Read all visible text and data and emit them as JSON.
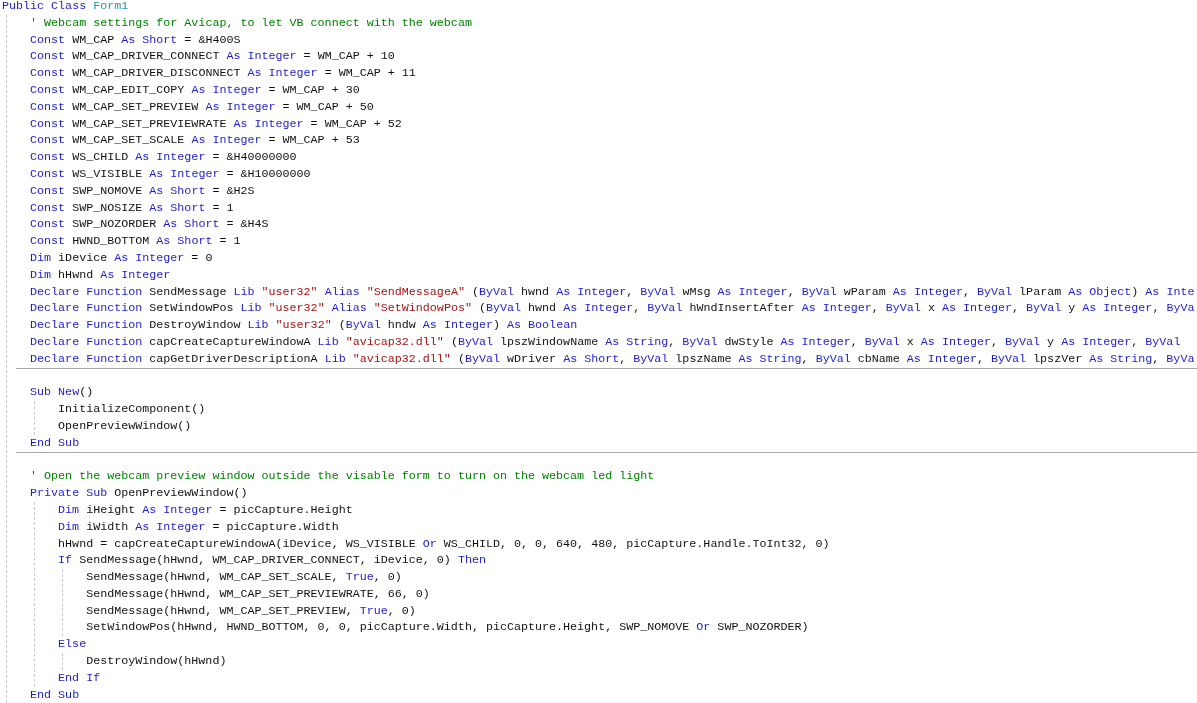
{
  "editor": {
    "lines": [
      {
        "tokens": [
          {
            "kind": "keyword",
            "text": "Public Class "
          },
          {
            "kind": "type",
            "text": "Form1"
          }
        ],
        "children": [
          {
            "tokens": [
              {
                "kind": "comment",
                "text": "' Webcam settings for Avicap, to let VB connect with the webcam"
              }
            ]
          },
          {
            "tokens": [
              {
                "kind": "keyword",
                "text": "Const"
              },
              {
                "kind": "plain",
                "text": " WM_CAP "
              },
              {
                "kind": "keyword",
                "text": "As Short"
              },
              {
                "kind": "plain",
                "text": " = &H400S"
              }
            ]
          },
          {
            "tokens": [
              {
                "kind": "keyword",
                "text": "Const"
              },
              {
                "kind": "plain",
                "text": " WM_CAP_DRIVER_CONNECT "
              },
              {
                "kind": "keyword",
                "text": "As Integer"
              },
              {
                "kind": "plain",
                "text": " = WM_CAP + 10"
              }
            ]
          },
          {
            "tokens": [
              {
                "kind": "keyword",
                "text": "Const"
              },
              {
                "kind": "plain",
                "text": " WM_CAP_DRIVER_DISCONNECT "
              },
              {
                "kind": "keyword",
                "text": "As Integer"
              },
              {
                "kind": "plain",
                "text": " = WM_CAP + 11"
              }
            ]
          },
          {
            "tokens": [
              {
                "kind": "keyword",
                "text": "Const"
              },
              {
                "kind": "plain",
                "text": " WM_CAP_EDIT_COPY "
              },
              {
                "kind": "keyword",
                "text": "As Integer"
              },
              {
                "kind": "plain",
                "text": " = WM_CAP + 30"
              }
            ]
          },
          {
            "tokens": [
              {
                "kind": "keyword",
                "text": "Const"
              },
              {
                "kind": "plain",
                "text": " WM_CAP_SET_PREVIEW "
              },
              {
                "kind": "keyword",
                "text": "As Integer"
              },
              {
                "kind": "plain",
                "text": " = WM_CAP + 50"
              }
            ]
          },
          {
            "tokens": [
              {
                "kind": "keyword",
                "text": "Const"
              },
              {
                "kind": "plain",
                "text": " WM_CAP_SET_PREVIEWRATE "
              },
              {
                "kind": "keyword",
                "text": "As Integer"
              },
              {
                "kind": "plain",
                "text": " = WM_CAP + 52"
              }
            ]
          },
          {
            "tokens": [
              {
                "kind": "keyword",
                "text": "Const"
              },
              {
                "kind": "plain",
                "text": " WM_CAP_SET_SCALE "
              },
              {
                "kind": "keyword",
                "text": "As Integer"
              },
              {
                "kind": "plain",
                "text": " = WM_CAP + 53"
              }
            ]
          },
          {
            "tokens": [
              {
                "kind": "keyword",
                "text": "Const"
              },
              {
                "kind": "plain",
                "text": " WS_CHILD "
              },
              {
                "kind": "keyword",
                "text": "As Integer"
              },
              {
                "kind": "plain",
                "text": " = &H40000000"
              }
            ]
          },
          {
            "tokens": [
              {
                "kind": "keyword",
                "text": "Const"
              },
              {
                "kind": "plain",
                "text": " WS_VISIBLE "
              },
              {
                "kind": "keyword",
                "text": "As Integer"
              },
              {
                "kind": "plain",
                "text": " = &H10000000"
              }
            ]
          },
          {
            "tokens": [
              {
                "kind": "keyword",
                "text": "Const"
              },
              {
                "kind": "plain",
                "text": " SWP_NOMOVE "
              },
              {
                "kind": "keyword",
                "text": "As Short"
              },
              {
                "kind": "plain",
                "text": " = &H2S"
              }
            ]
          },
          {
            "tokens": [
              {
                "kind": "keyword",
                "text": "Const"
              },
              {
                "kind": "plain",
                "text": " SWP_NOSIZE "
              },
              {
                "kind": "keyword",
                "text": "As Short"
              },
              {
                "kind": "plain",
                "text": " = 1"
              }
            ]
          },
          {
            "tokens": [
              {
                "kind": "keyword",
                "text": "Const"
              },
              {
                "kind": "plain",
                "text": " SWP_NOZORDER "
              },
              {
                "kind": "keyword",
                "text": "As Short"
              },
              {
                "kind": "plain",
                "text": " = &H4S"
              }
            ]
          },
          {
            "tokens": [
              {
                "kind": "keyword",
                "text": "Const"
              },
              {
                "kind": "plain",
                "text": " HWND_BOTTOM "
              },
              {
                "kind": "keyword",
                "text": "As Short"
              },
              {
                "kind": "plain",
                "text": " = 1"
              }
            ]
          },
          {
            "tokens": [
              {
                "kind": "keyword",
                "text": "Dim"
              },
              {
                "kind": "plain",
                "text": " iDevice "
              },
              {
                "kind": "keyword",
                "text": "As Integer"
              },
              {
                "kind": "plain",
                "text": " = 0"
              }
            ]
          },
          {
            "tokens": [
              {
                "kind": "keyword",
                "text": "Dim"
              },
              {
                "kind": "plain",
                "text": " hHwnd "
              },
              {
                "kind": "keyword",
                "text": "As Integer"
              }
            ]
          },
          {
            "tokens": [
              {
                "kind": "keyword",
                "text": "Declare Function"
              },
              {
                "kind": "plain",
                "text": " SendMessage "
              },
              {
                "kind": "keyword",
                "text": "Lib "
              },
              {
                "kind": "string",
                "text": "\"user32\""
              },
              {
                "kind": "keyword",
                "text": " Alias "
              },
              {
                "kind": "string",
                "text": "\"SendMessageA\""
              },
              {
                "kind": "plain",
                "text": " ("
              },
              {
                "kind": "keyword",
                "text": "ByVal"
              },
              {
                "kind": "plain",
                "text": " hwnd "
              },
              {
                "kind": "keyword",
                "text": "As Integer"
              },
              {
                "kind": "plain",
                "text": ", "
              },
              {
                "kind": "keyword",
                "text": "ByVal"
              },
              {
                "kind": "plain",
                "text": " wMsg "
              },
              {
                "kind": "keyword",
                "text": "As Integer"
              },
              {
                "kind": "plain",
                "text": ", "
              },
              {
                "kind": "keyword",
                "text": "ByVal"
              },
              {
                "kind": "plain",
                "text": " wParam "
              },
              {
                "kind": "keyword",
                "text": "As Integer"
              },
              {
                "kind": "plain",
                "text": ", "
              },
              {
                "kind": "keyword",
                "text": "ByVal"
              },
              {
                "kind": "plain",
                "text": " lParam "
              },
              {
                "kind": "keyword",
                "text": "As Object"
              },
              {
                "kind": "plain",
                "text": ") "
              },
              {
                "kind": "keyword",
                "text": "As Inte"
              }
            ]
          },
          {
            "tokens": [
              {
                "kind": "keyword",
                "text": "Declare Function"
              },
              {
                "kind": "plain",
                "text": " SetWindowPos "
              },
              {
                "kind": "keyword",
                "text": "Lib "
              },
              {
                "kind": "string",
                "text": "\"user32\""
              },
              {
                "kind": "keyword",
                "text": " Alias "
              },
              {
                "kind": "string",
                "text": "\"SetWindowPos\""
              },
              {
                "kind": "plain",
                "text": " ("
              },
              {
                "kind": "keyword",
                "text": "ByVal"
              },
              {
                "kind": "plain",
                "text": " hwnd "
              },
              {
                "kind": "keyword",
                "text": "As Integer"
              },
              {
                "kind": "plain",
                "text": ", "
              },
              {
                "kind": "keyword",
                "text": "ByVal"
              },
              {
                "kind": "plain",
                "text": " hWndInsertAfter "
              },
              {
                "kind": "keyword",
                "text": "As Integer"
              },
              {
                "kind": "plain",
                "text": ", "
              },
              {
                "kind": "keyword",
                "text": "ByVal"
              },
              {
                "kind": "plain",
                "text": " x "
              },
              {
                "kind": "keyword",
                "text": "As Integer"
              },
              {
                "kind": "plain",
                "text": ", "
              },
              {
                "kind": "keyword",
                "text": "ByVal"
              },
              {
                "kind": "plain",
                "text": " y "
              },
              {
                "kind": "keyword",
                "text": "As Integer"
              },
              {
                "kind": "plain",
                "text": ", "
              },
              {
                "kind": "keyword",
                "text": "ByVa"
              }
            ]
          },
          {
            "tokens": [
              {
                "kind": "keyword",
                "text": "Declare Function"
              },
              {
                "kind": "plain",
                "text": " DestroyWindow "
              },
              {
                "kind": "keyword",
                "text": "Lib "
              },
              {
                "kind": "string",
                "text": "\"user32\""
              },
              {
                "kind": "plain",
                "text": " ("
              },
              {
                "kind": "keyword",
                "text": "ByVal"
              },
              {
                "kind": "plain",
                "text": " hndw "
              },
              {
                "kind": "keyword",
                "text": "As Integer"
              },
              {
                "kind": "plain",
                "text": ") "
              },
              {
                "kind": "keyword",
                "text": "As Boolean"
              }
            ]
          },
          {
            "tokens": [
              {
                "kind": "keyword",
                "text": "Declare Function"
              },
              {
                "kind": "plain",
                "text": " capCreateCaptureWindowA "
              },
              {
                "kind": "keyword",
                "text": "Lib "
              },
              {
                "kind": "string",
                "text": "\"avicap32.dll\""
              },
              {
                "kind": "plain",
                "text": " ("
              },
              {
                "kind": "keyword",
                "text": "ByVal"
              },
              {
                "kind": "plain",
                "text": " lpszWindowName "
              },
              {
                "kind": "keyword",
                "text": "As String"
              },
              {
                "kind": "plain",
                "text": ", "
              },
              {
                "kind": "keyword",
                "text": "ByVal"
              },
              {
                "kind": "plain",
                "text": " dwStyle "
              },
              {
                "kind": "keyword",
                "text": "As Integer"
              },
              {
                "kind": "plain",
                "text": ", "
              },
              {
                "kind": "keyword",
                "text": "ByVal"
              },
              {
                "kind": "plain",
                "text": " x "
              },
              {
                "kind": "keyword",
                "text": "As Integer"
              },
              {
                "kind": "plain",
                "text": ", "
              },
              {
                "kind": "keyword",
                "text": "ByVal"
              },
              {
                "kind": "plain",
                "text": " y "
              },
              {
                "kind": "keyword",
                "text": "As Integer"
              },
              {
                "kind": "plain",
                "text": ", "
              },
              {
                "kind": "keyword",
                "text": "ByVal"
              }
            ]
          },
          {
            "tokens": [
              {
                "kind": "keyword",
                "text": "Declare Function"
              },
              {
                "kind": "plain",
                "text": " capGetDriverDescriptionA "
              },
              {
                "kind": "keyword",
                "text": "Lib "
              },
              {
                "kind": "string",
                "text": "\"avicap32.dll\""
              },
              {
                "kind": "plain",
                "text": " ("
              },
              {
                "kind": "keyword",
                "text": "ByVal"
              },
              {
                "kind": "plain",
                "text": " wDriver "
              },
              {
                "kind": "keyword",
                "text": "As Short"
              },
              {
                "kind": "plain",
                "text": ", "
              },
              {
                "kind": "keyword",
                "text": "ByVal"
              },
              {
                "kind": "plain",
                "text": " lpszName "
              },
              {
                "kind": "keyword",
                "text": "As String"
              },
              {
                "kind": "plain",
                "text": ", "
              },
              {
                "kind": "keyword",
                "text": "ByVal"
              },
              {
                "kind": "plain",
                "text": " cbName "
              },
              {
                "kind": "keyword",
                "text": "As Integer"
              },
              {
                "kind": "plain",
                "text": ", "
              },
              {
                "kind": "keyword",
                "text": "ByVal"
              },
              {
                "kind": "plain",
                "text": " lpszVer "
              },
              {
                "kind": "keyword",
                "text": "As String"
              },
              {
                "kind": "plain",
                "text": ", "
              },
              {
                "kind": "keyword",
                "text": "ByVa"
              }
            ]
          },
          {
            "divider": true
          },
          {
            "tokens": [
              {
                "kind": "keyword",
                "text": "Sub New"
              },
              {
                "kind": "plain",
                "text": "()"
              }
            ],
            "children": [
              {
                "tokens": [
                  {
                    "kind": "plain",
                    "text": "InitializeComponent()"
                  }
                ]
              },
              {
                "tokens": [
                  {
                    "kind": "plain",
                    "text": "OpenPreviewWindow()"
                  }
                ]
              }
            ]
          },
          {
            "tokens": [
              {
                "kind": "keyword",
                "text": "End Sub"
              }
            ]
          },
          {
            "divider": true
          },
          {
            "tokens": [
              {
                "kind": "comment",
                "text": "' Open the webcam preview window outside the visable form to turn on the webcam led light"
              }
            ]
          },
          {
            "tokens": [
              {
                "kind": "keyword",
                "text": "Private Sub"
              },
              {
                "kind": "plain",
                "text": " OpenPreviewWindow()"
              }
            ],
            "children": [
              {
                "tokens": [
                  {
                    "kind": "keyword",
                    "text": "Dim"
                  },
                  {
                    "kind": "plain",
                    "text": " iHeight "
                  },
                  {
                    "kind": "keyword",
                    "text": "As Integer"
                  },
                  {
                    "kind": "plain",
                    "text": " = picCapture.Height"
                  }
                ]
              },
              {
                "tokens": [
                  {
                    "kind": "keyword",
                    "text": "Dim"
                  },
                  {
                    "kind": "plain",
                    "text": " iWidth "
                  },
                  {
                    "kind": "keyword",
                    "text": "As Integer"
                  },
                  {
                    "kind": "plain",
                    "text": " = picCapture.Width"
                  }
                ]
              },
              {
                "tokens": [
                  {
                    "kind": "plain",
                    "text": "hHwnd = capCreateCaptureWindowA(iDevice, WS_VISIBLE "
                  },
                  {
                    "kind": "keyword",
                    "text": "Or"
                  },
                  {
                    "kind": "plain",
                    "text": " WS_CHILD, 0, 0, 640, 480, picCapture.Handle.ToInt32, 0)"
                  }
                ]
              },
              {
                "tokens": [
                  {
                    "kind": "keyword",
                    "text": "If"
                  },
                  {
                    "kind": "plain",
                    "text": " SendMessage(hHwnd, WM_CAP_DRIVER_CONNECT, iDevice, 0) "
                  },
                  {
                    "kind": "keyword",
                    "text": "Then"
                  }
                ],
                "children": [
                  {
                    "tokens": [
                      {
                        "kind": "plain",
                        "text": "SendMessage(hHwnd, WM_CAP_SET_SCALE, "
                      },
                      {
                        "kind": "keyword",
                        "text": "True"
                      },
                      {
                        "kind": "plain",
                        "text": ", 0)"
                      }
                    ]
                  },
                  {
                    "tokens": [
                      {
                        "kind": "plain",
                        "text": "SendMessage(hHwnd, WM_CAP_SET_PREVIEWRATE, 66, 0)"
                      }
                    ]
                  },
                  {
                    "tokens": [
                      {
                        "kind": "plain",
                        "text": "SendMessage(hHwnd, WM_CAP_SET_PREVIEW, "
                      },
                      {
                        "kind": "keyword",
                        "text": "True"
                      },
                      {
                        "kind": "plain",
                        "text": ", 0)"
                      }
                    ]
                  },
                  {
                    "tokens": [
                      {
                        "kind": "plain",
                        "text": "SetWindowPos(hHwnd, HWND_BOTTOM, 0, 0, picCapture.Width, picCapture.Height, SWP_NOMOVE "
                      },
                      {
                        "kind": "keyword",
                        "text": "Or"
                      },
                      {
                        "kind": "plain",
                        "text": " SWP_NOZORDER)"
                      }
                    ]
                  }
                ]
              },
              {
                "tokens": [
                  {
                    "kind": "keyword",
                    "text": "Else"
                  }
                ],
                "children": [
                  {
                    "tokens": [
                      {
                        "kind": "plain",
                        "text": "DestroyWindow(hHwnd)"
                      }
                    ]
                  }
                ]
              },
              {
                "tokens": [
                  {
                    "kind": "keyword",
                    "text": "End If"
                  }
                ]
              }
            ]
          },
          {
            "tokens": [
              {
                "kind": "keyword",
                "text": "End Sub"
              }
            ]
          }
        ]
      }
    ]
  }
}
